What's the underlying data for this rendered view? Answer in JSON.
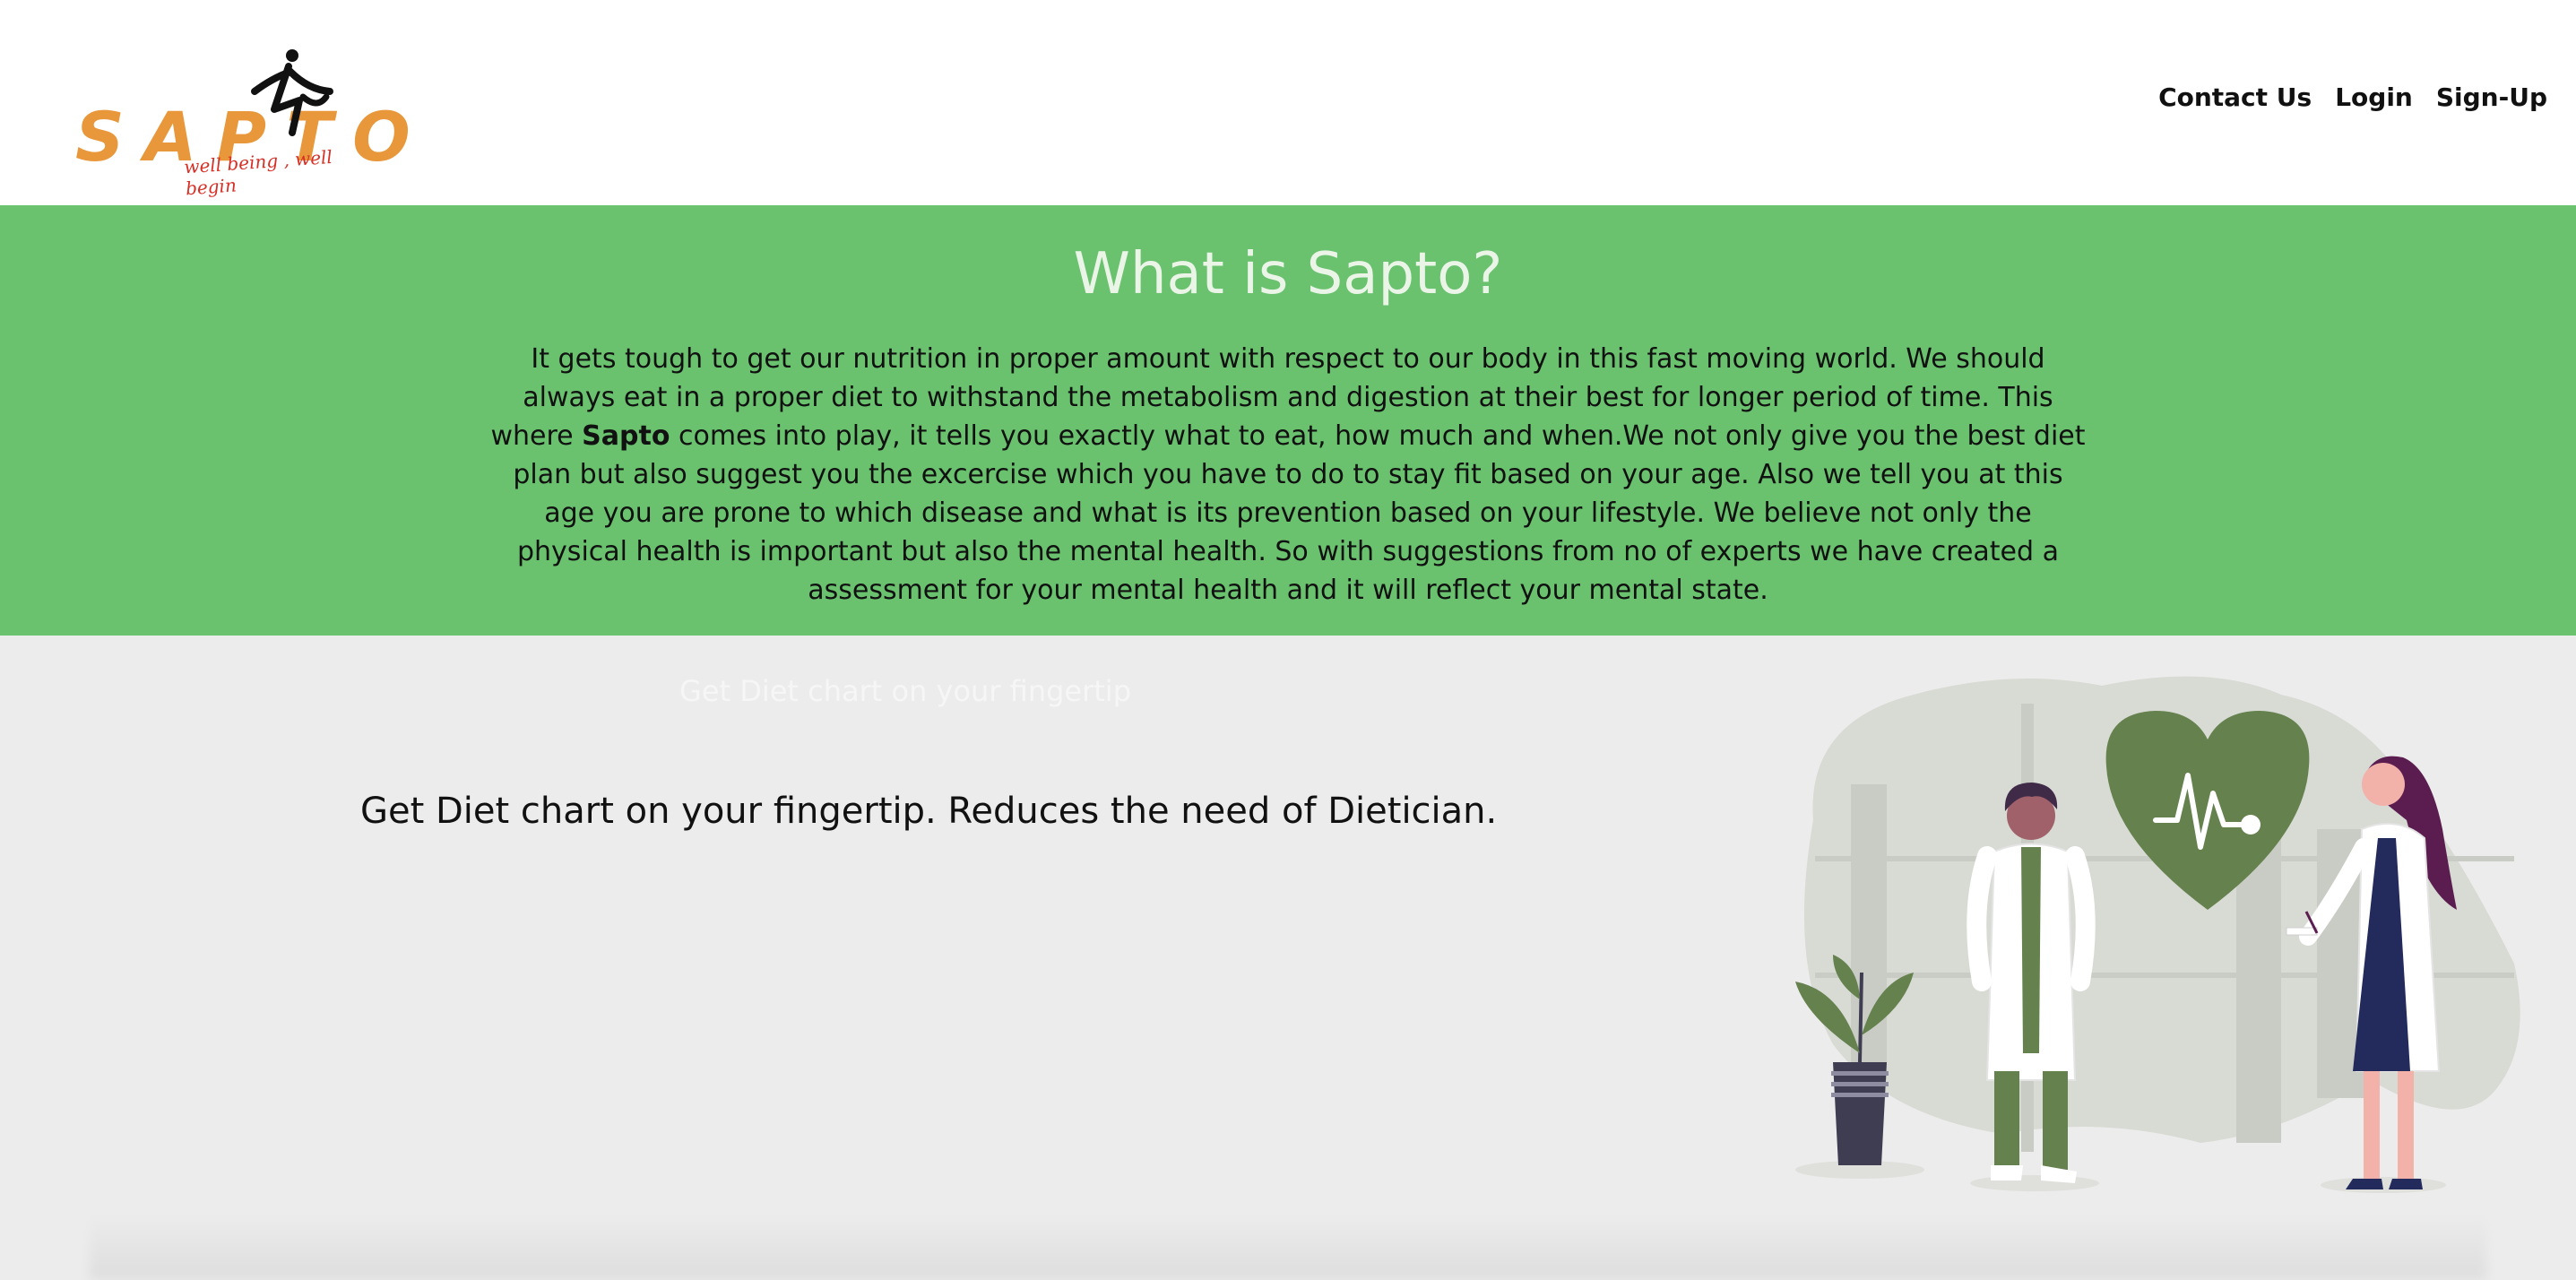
{
  "brand": {
    "name": "SAPTO",
    "tagline": "well being , well begin",
    "orange": "#e8973a",
    "tag_red": "#d62f25"
  },
  "nav": [
    {
      "label": "Contact Us"
    },
    {
      "label": "Login"
    },
    {
      "label": "Sign-Up"
    }
  ],
  "about": {
    "title": "What is Sapto?",
    "text_before": "It gets tough to get our nutrition in proper amount with respect to our body in this fast moving world. We should always eat in a proper diet to withstand the metabolism and digestion at their best for longer period of time. This where ",
    "text_bold": "Sapto",
    "text_after": " comes into play, it tells you exactly what to eat, how much and when.We not only give you the best diet plan but also suggest you the excercise which you have to do to stay fit based on your age. Also we tell you at this age you are prone to which disease and what is its prevention based on your lifestyle. We believe not only the physical health is important but also the mental health. So with suggestions from no of experts we have created a assessment for your mental health and it will reflect your mental state.",
    "band_color": "#6ac26f"
  },
  "feature": {
    "ghost_text": "Get Diet chart on your fingertip",
    "headline": "Get Diet chart on your fingertip. Reduces the need of Dietician."
  },
  "illustration": {
    "icons": [
      "heart-pulse-icon",
      "plant-icon",
      "doctor-figure",
      "nurse-figure"
    ]
  }
}
